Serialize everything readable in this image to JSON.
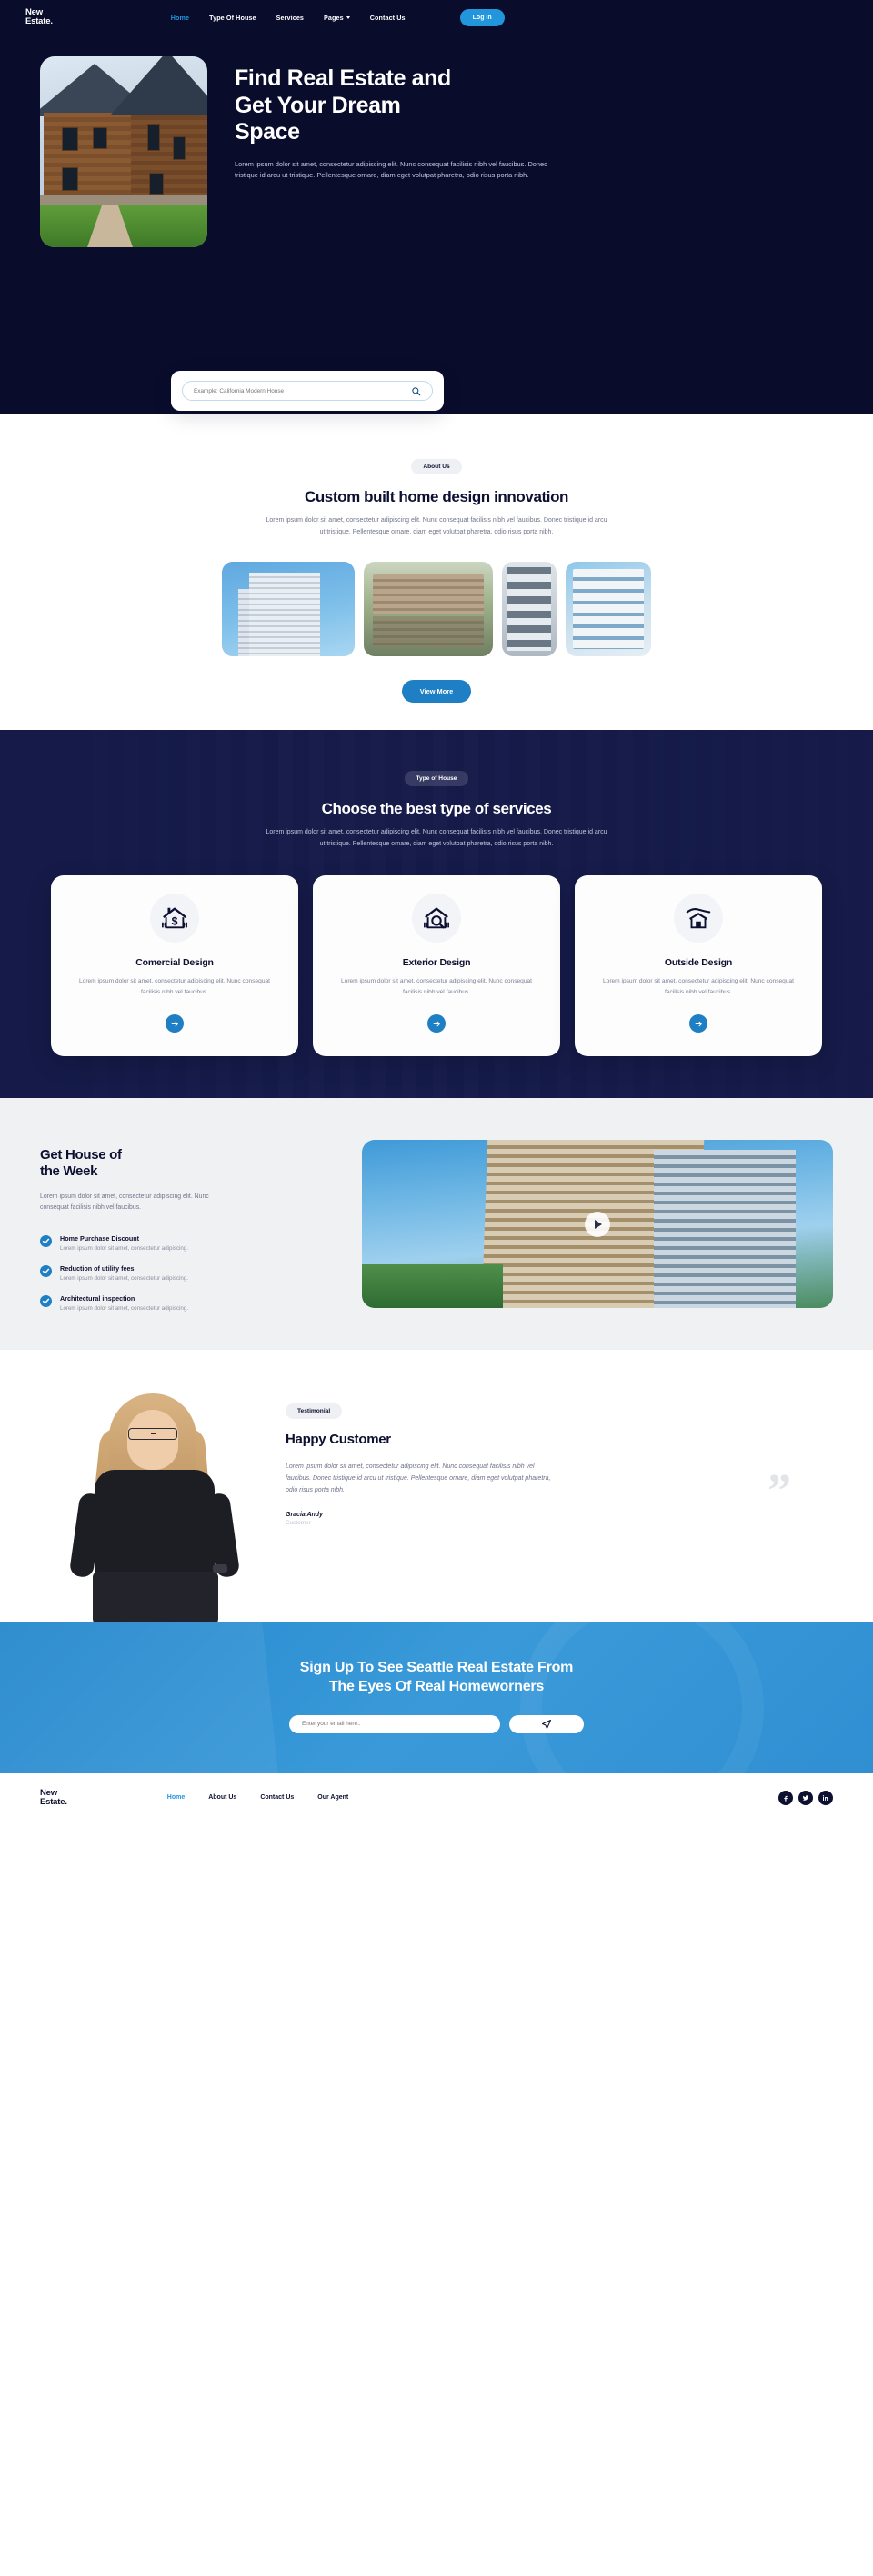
{
  "brand": {
    "line1": "New",
    "line2": "Estate."
  },
  "colors": {
    "navy": "#0a0c2c",
    "deep_navy": "#151a48",
    "accent_blue": "#2196dd",
    "button_blue": "#1f7fc4",
    "muted_text": "#70748c",
    "light_grey_bg": "#f0f1f3"
  },
  "nav": {
    "items": [
      {
        "label": "Home",
        "active": true,
        "has_chevron": false
      },
      {
        "label": "Type Of House",
        "active": false,
        "has_chevron": false
      },
      {
        "label": "Services",
        "active": false,
        "has_chevron": false
      },
      {
        "label": "Pages",
        "active": false,
        "has_chevron": true
      },
      {
        "label": "Contact Us",
        "active": false,
        "has_chevron": false
      }
    ],
    "login_label": "Log In"
  },
  "hero": {
    "title": "Find Real Estate and\nGet Your Dream\nSpace",
    "subtitle": "Lorem ipsum dolor sit amet, consectetur adipiscing elit. Nunc consequat facilisis nibh vel faucibus. Donec tristique id arcu ut tristique. Pellentesque ornare, diam eget volutpat pharetra, odio risus porta nibh.",
    "image_alt": "wooden-house-photo",
    "search": {
      "placeholder": "Example: California Modern House",
      "value": "",
      "icon": "search-icon"
    }
  },
  "about": {
    "badge": "About Us",
    "title": "Custom built home design innovation",
    "subtitle": "Lorem ipsum dolor sit amet, consectetur adipiscing elit. Nunc consequat facilisis nibh vel faucibus. Donec tristique id arcu ut tristique. Pellentesque ornare, diam eget volutpat pharetra, odio risus porta nibh.",
    "gallery": [
      {
        "alt": "highrise-apartment-tower"
      },
      {
        "alt": "waterfront-building-reflection"
      },
      {
        "alt": "building-facade-strip"
      },
      {
        "alt": "modern-balcony-block"
      }
    ],
    "cta_label": "View More"
  },
  "services": {
    "badge": "Type of House",
    "title": "Choose the best type of services",
    "subtitle": "Lorem ipsum dolor sit amet, consectetur adipiscing elit. Nunc consequat facilisis nibh vel faucibus. Donec tristique id arcu ut tristique. Pellentesque ornare, diam eget volutpat pharetra, odio risus porta nibh.",
    "cards": [
      {
        "icon": "house-dollar-icon",
        "title": "Comercial Design",
        "desc": "Lorem ipsum dolor sit amet, consectetur adipiscing elit. Nunc consequat facilisis nibh vel faucibus.",
        "arrow": "arrow-right-icon"
      },
      {
        "icon": "house-magnifier-icon",
        "title": "Exterior Design",
        "desc": "Lorem ipsum dolor sit amet, consectetur adipiscing elit. Nunc consequat facilisis nibh vel faucibus.",
        "arrow": "arrow-right-icon"
      },
      {
        "icon": "house-hand-icon",
        "title": "Outside Design",
        "desc": "Lorem ipsum dolor sit amet, consectetur adipiscing elit. Nunc consequat facilisis nibh vel faucibus.",
        "arrow": "arrow-right-icon"
      }
    ]
  },
  "week": {
    "title": "Get House of\nthe Week",
    "subtitle": "Lorem ipsum dolor sit amet, consectetur adipiscing elit. Nunc consequat facilisis nibh vel faucibus.",
    "features": [
      {
        "icon": "check-circle-icon",
        "title": "Home Purchase Discount",
        "desc": "Lorem ipsum dolor sit amet, consectetur adipiscing."
      },
      {
        "icon": "check-circle-icon",
        "title": "Reduction of utility fees",
        "desc": "Lorem ipsum dolor sit amet, consectetur adipiscing."
      },
      {
        "icon": "check-circle-icon",
        "title": "Architectural inspection",
        "desc": "Lorem ipsum dolor sit amet, consectetur adipiscing."
      }
    ],
    "video": {
      "alt": "apartment-tower-video",
      "play_icon": "play-icon"
    }
  },
  "testimonial": {
    "badge": "Testimonial",
    "title": "Happy Customer",
    "quote": "Lorem ipsum dolor sit amet, consectetur adipiscing elit. Nunc consequat facilisis nibh vel faucibus. Donec tristique id arcu ut tristique. Pellentesque ornare, diam eget volutpat pharetra, odio risus porta nibh.",
    "author": "Gracia Andy",
    "role": "Customer",
    "quote_mark": "”",
    "photo_alt": "smiling-woman-portrait"
  },
  "newsletter": {
    "title": "Sign Up To See Seattle Real Estate From\nThe Eyes Of Real Homeworners",
    "input_placeholder": "Enter your email here..",
    "input_value": "",
    "submit_icon": "paper-plane-icon"
  },
  "footer": {
    "links": [
      {
        "label": "Home",
        "active": true
      },
      {
        "label": "About Us",
        "active": false
      },
      {
        "label": "Contact Us",
        "active": false
      },
      {
        "label": "Our Agent",
        "active": false
      }
    ],
    "socials": [
      {
        "name": "facebook-icon",
        "glyph": "f"
      },
      {
        "name": "twitter-icon",
        "glyph": "t"
      },
      {
        "name": "linkedin-icon",
        "glyph": "in"
      }
    ]
  }
}
